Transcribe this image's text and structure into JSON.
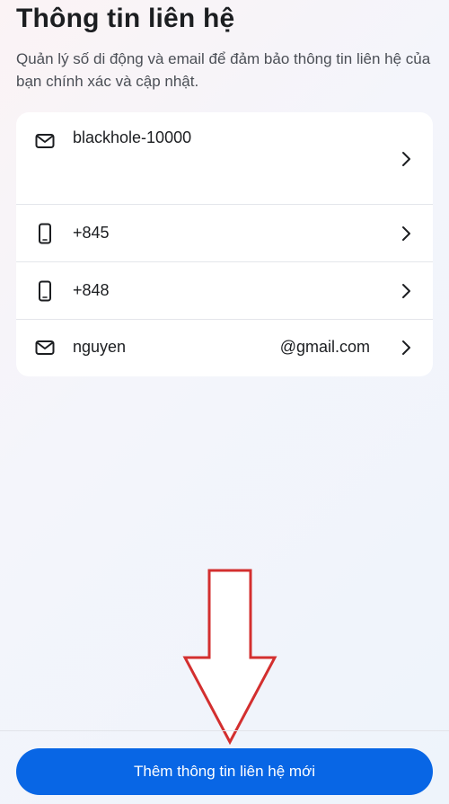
{
  "header": {
    "title": "Thông tin liên hệ",
    "subtitle": "Quản lý số di động và email để đảm bảo thông tin liên hệ của bạn chính xác và cập nhật."
  },
  "contacts": [
    {
      "type": "email",
      "icon": "mail-icon",
      "value": "blackhole-10000",
      "value_suffix": ""
    },
    {
      "type": "phone",
      "icon": "phone-icon",
      "value": "+845",
      "value_suffix": ""
    },
    {
      "type": "phone",
      "icon": "phone-icon",
      "value": "+848",
      "value_suffix": ""
    },
    {
      "type": "email",
      "icon": "mail-icon",
      "value": "nguyen",
      "value_suffix": "@gmail.com"
    }
  ],
  "footer": {
    "add_button_label": "Thêm thông tin liên hệ mới"
  },
  "colors": {
    "accent": "#0866e5",
    "arrow": "#d32f2f"
  }
}
